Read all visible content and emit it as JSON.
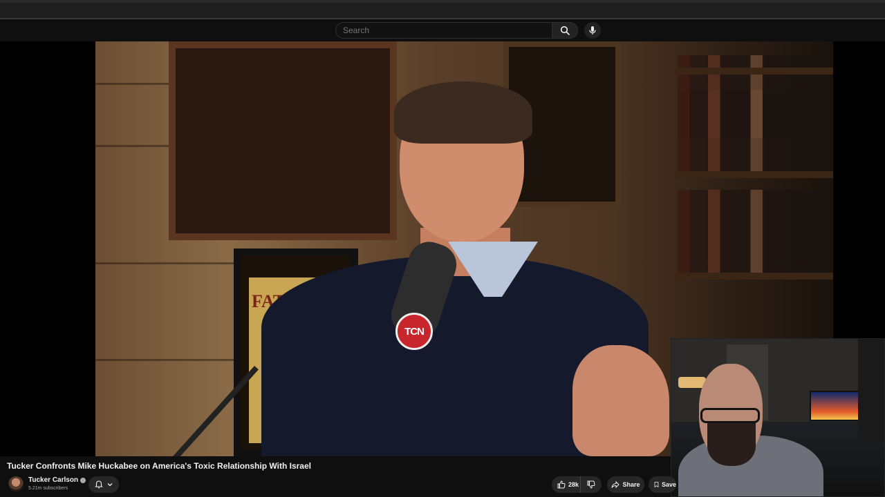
{
  "masthead": {
    "search_placeholder": "Search"
  },
  "video": {
    "overlay_text": {
      "mic_logo": "TCN",
      "poster_text": "FATIMA"
    }
  },
  "meta": {
    "title": "Tucker Confronts Mike Huckabee on America's Toxic Relationship With Israel",
    "channel_name": "Tucker Carlson",
    "subscribers": "5.21m subscribers"
  },
  "actions": {
    "like_count": "28k",
    "share_label": "Share",
    "save_label": "Save"
  }
}
